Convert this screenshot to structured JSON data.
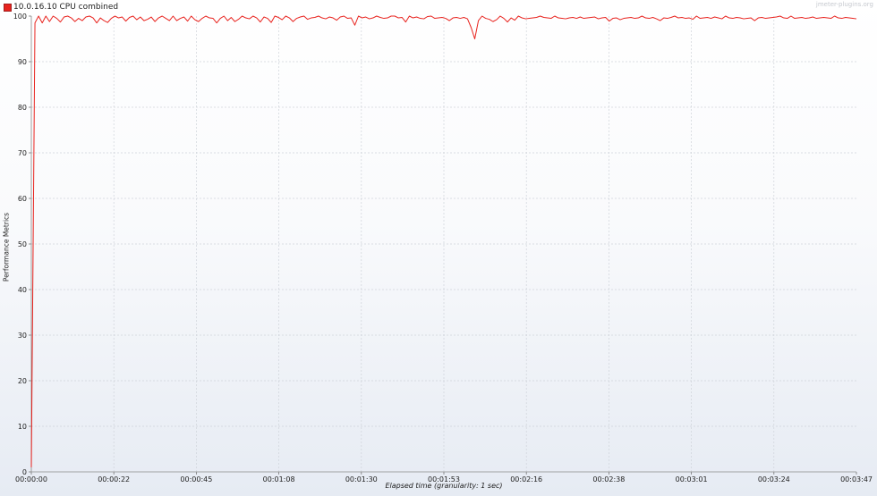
{
  "chart_data": {
    "type": "line",
    "title": "",
    "xlabel": "Elapsed time (granularity: 1 sec)",
    "ylabel": "Performance Metrics",
    "watermark": "jmeter-plugins.org",
    "grid": true,
    "legend_position": "top-left",
    "xlim_seconds": [
      0,
      227
    ],
    "ylim": [
      0,
      100
    ],
    "x_tick_labels": [
      "00:00:00",
      "00:00:22",
      "00:00:45",
      "00:01:08",
      "00:01:30",
      "00:01:53",
      "00:02:16",
      "00:02:38",
      "00:03:01",
      "00:03:24",
      "00:03:47"
    ],
    "y_tick_labels": [
      "0",
      "10",
      "20",
      "30",
      "40",
      "50",
      "60",
      "70",
      "80",
      "90",
      "100"
    ],
    "series": [
      {
        "name": "10.0.16.10 CPU combined",
        "color": "#e8231e",
        "x_seconds": [
          0,
          1,
          2,
          3,
          4,
          5,
          6,
          7,
          8,
          9,
          10,
          11,
          12,
          13,
          14,
          15,
          16,
          17,
          18,
          19,
          20,
          21,
          22,
          23,
          24,
          25,
          26,
          27,
          28,
          29,
          30,
          31,
          32,
          33,
          34,
          35,
          36,
          37,
          38,
          39,
          40,
          41,
          42,
          43,
          44,
          45,
          46,
          47,
          48,
          49,
          50,
          51,
          52,
          53,
          54,
          55,
          56,
          57,
          58,
          59,
          60,
          61,
          62,
          63,
          64,
          65,
          66,
          67,
          68,
          69,
          70,
          71,
          72,
          73,
          74,
          75,
          76,
          77,
          78,
          79,
          80,
          81,
          82,
          83,
          84,
          85,
          86,
          87,
          88,
          89,
          90,
          91,
          92,
          93,
          94,
          95,
          96,
          97,
          98,
          99,
          100,
          101,
          102,
          103,
          104,
          105,
          106,
          107,
          108,
          109,
          110,
          111,
          112,
          113,
          114,
          115,
          116,
          117,
          118,
          119,
          120,
          121,
          122,
          123,
          124,
          125,
          126,
          127,
          128,
          129,
          130,
          131,
          132,
          133,
          134,
          135,
          136,
          137,
          138,
          139,
          140,
          141,
          142,
          143,
          144,
          145,
          146,
          147,
          148,
          149,
          150,
          151,
          152,
          153,
          154,
          155,
          156,
          157,
          158,
          159,
          160,
          161,
          162,
          163,
          164,
          165,
          166,
          167,
          168,
          169,
          170,
          171,
          172,
          173,
          174,
          175,
          176,
          177,
          178,
          179,
          180,
          181,
          182,
          183,
          184,
          185,
          186,
          187,
          188,
          189,
          190,
          191,
          192,
          193,
          194,
          195,
          196,
          197,
          198,
          199,
          200,
          201,
          202,
          203,
          204,
          205,
          206,
          207,
          208,
          209,
          210,
          211,
          212,
          213,
          214,
          215,
          216,
          217,
          218,
          219,
          220,
          221,
          222,
          223,
          224,
          225,
          226,
          227
        ],
        "values": [
          1,
          98.5,
          100,
          98.5,
          100,
          98.8,
          100,
          99.5,
          98.7,
          99.8,
          100,
          99.6,
          98.8,
          99.5,
          99,
          99.8,
          100,
          99.6,
          98.5,
          99.6,
          99,
          98.6,
          99.5,
          100,
          99.6,
          99.8,
          98.9,
          99.7,
          100,
          99.2,
          99.8,
          99,
          99.3,
          99.8,
          98.8,
          99.6,
          100,
          99.5,
          99,
          100,
          99,
          99.5,
          99.8,
          98.9,
          100,
          99.2,
          98.8,
          99.5,
          100,
          99.6,
          99.5,
          98.5,
          99.5,
          100,
          99,
          99.7,
          98.8,
          99.3,
          100,
          99.6,
          99.4,
          100,
          99.6,
          98.7,
          99.8,
          99.5,
          98.6,
          100,
          99.7,
          99.2,
          100,
          99.6,
          98.8,
          99.5,
          99.8,
          100,
          99.3,
          99.6,
          99.7,
          100,
          99.6,
          99.4,
          99.8,
          99.6,
          99.1,
          99.8,
          100,
          99.5,
          99.6,
          98,
          100,
          99.6,
          99.8,
          99.4,
          99.6,
          100,
          99.7,
          99.5,
          99.6,
          100,
          100,
          99.6,
          99.7,
          98.7,
          100,
          99.6,
          99.8,
          99.5,
          99.4,
          99.9,
          100,
          99.5,
          99.6,
          99.7,
          99.5,
          99,
          99.6,
          99.7,
          99.5,
          99.7,
          99.4,
          97.5,
          95,
          99,
          100,
          99.5,
          99.3,
          98.8,
          99.2,
          100,
          99.5,
          98.7,
          99.6,
          99.1,
          100,
          99.6,
          99.4,
          99.5,
          99.6,
          99.7,
          100,
          99.7,
          99.6,
          99.5,
          100,
          99.6,
          99.5,
          99.4,
          99.6,
          99.7,
          99.5,
          99.8,
          99.5,
          99.6,
          99.7,
          99.8,
          99.4,
          99.6,
          99.7,
          98.9,
          99.5,
          99.6,
          99.2,
          99.5,
          99.6,
          99.7,
          99.5,
          99.6,
          100,
          99.6,
          99.5,
          99.7,
          99.4,
          99,
          99.6,
          99.5,
          99.7,
          100,
          99.6,
          99.7,
          99.5,
          99.6,
          99.3,
          100,
          99.5,
          99.6,
          99.7,
          99.5,
          99.8,
          99.6,
          99.4,
          100,
          99.6,
          99.5,
          99.7,
          99.6,
          99.4,
          99.5,
          99.6,
          99,
          99.6,
          99.7,
          99.5,
          99.6,
          99.7,
          99.8,
          100,
          99.6,
          99.5,
          100,
          99.5,
          99.6,
          99.7,
          99.5,
          99.6,
          99.8,
          99.5,
          99.6,
          99.7,
          99.6,
          99.5,
          100,
          99.6,
          99.5,
          99.7,
          99.6,
          99.5,
          99.4,
          99.6,
          99.7,
          99.6,
          99.5,
          99.6,
          100,
          99.4,
          99.6,
          99.5,
          99.7,
          99.6,
          99.5,
          99.4,
          99.2,
          99
        ]
      }
    ]
  }
}
